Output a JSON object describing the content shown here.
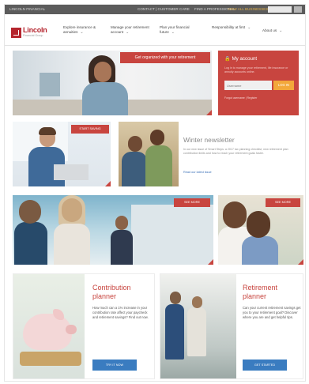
{
  "topbar": {
    "left_label": "LINCOLN FINANCIAL",
    "links": [
      "CONTACT | CUSTOMER CARE",
      "FIND A PROFESSIONAL",
      "VIEW ALL BUSINESSES"
    ],
    "search_placeholder": "Search"
  },
  "header": {
    "logo_name": "Lincoln",
    "logo_sub": "Financial Group",
    "nav": [
      "Explore insurance & annuities",
      "Manage your retirement account",
      "Plan your financial future",
      "Responsibility at first",
      "About us"
    ]
  },
  "hero": {
    "banner": "Get organized with your retirement"
  },
  "account": {
    "title": "My account",
    "description": "Log in to manage your retirement, life insurance or annuity accounts online.",
    "username_placeholder": "Username",
    "login_label": "LOG IN",
    "links": "Forgot username | Register"
  },
  "row2": {
    "tag": "START SAVING",
    "newsletter_title": "Winter newsletter",
    "newsletter_text": "In our new issue of Smart Steps: a 2017 tax planning checklist, new retirement plan contribution limits and how to reach your retirement goals faster.",
    "newsletter_link": "Read our latest issue"
  },
  "row3": {
    "tag_left": "SEE MORE",
    "tag_right": "SEE MORE"
  },
  "cards": [
    {
      "title": "Contribution planner",
      "text": "How much can a 1% increase in your contribution rate affect your paycheck and retirement savings? Find out now.",
      "button": "TRY IT NOW"
    },
    {
      "title": "Retirement planner",
      "text": "Can your current retirement savings get you to your retirement goal? Discover where you are and get helpful tips.",
      "button": "GET STARTED"
    }
  ],
  "colors": {
    "brand_red": "#c8453f",
    "topbar": "#5c5c5c",
    "login_orange": "#f3a83a",
    "button_blue": "#3a7cc0"
  }
}
